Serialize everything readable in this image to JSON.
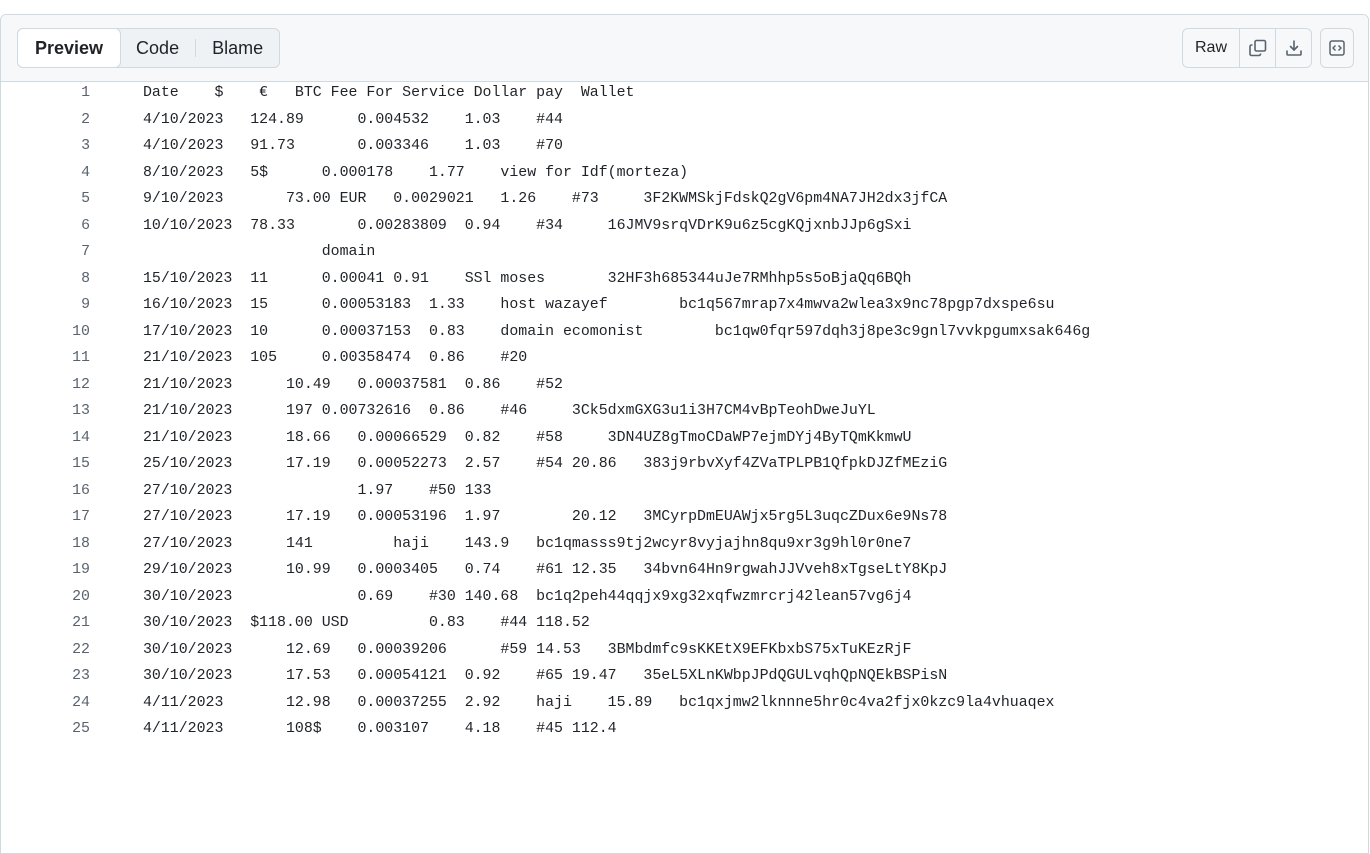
{
  "tabs": {
    "preview": "Preview",
    "code": "Code",
    "blame": "Blame"
  },
  "toolbar": {
    "raw": "Raw",
    "copy_icon": "copy-icon",
    "download_icon": "download-icon",
    "symbols_icon": "code-symbols-icon"
  },
  "lines": [
    {
      "n": "1",
      "text": "Date    $    €   BTC Fee For Service Dollar pay  Wallet"
    },
    {
      "n": "2",
      "text": "4/10/2023   124.89      0.004532    1.03    #44"
    },
    {
      "n": "3",
      "text": "4/10/2023   91.73       0.003346    1.03    #70"
    },
    {
      "n": "4",
      "text": "8/10/2023   5$      0.000178    1.77    view for Idf(morteza)"
    },
    {
      "n": "5",
      "text": "9/10/2023       73.00 EUR   0.0029021   1.26    #73     3F2KWMSkjFdskQ2gV6pm4NA7JH2dx3jfCA"
    },
    {
      "n": "6",
      "text": "10/10/2023  78.33       0.00283809  0.94    #34     16JMV9srqVDrK9u6z5cgKQjxnbJJp6gSxi"
    },
    {
      "n": "7",
      "text": "                    domain"
    },
    {
      "n": "8",
      "text": "15/10/2023  11      0.00041 0.91    SSl moses       32HF3h685344uJe7RMhhp5s5oBjaQq6BQh"
    },
    {
      "n": "9",
      "text": "16/10/2023  15      0.00053183  1.33    host wazayef        bc1q567mrap7x4mwva2wlea3x9nc78pgp7dxspe6su"
    },
    {
      "n": "10",
      "text": "17/10/2023  10      0.00037153  0.83    domain ecomonist        bc1qw0fqr597dqh3j8pe3c9gnl7vvkpgumxsak646g"
    },
    {
      "n": "11",
      "text": "21/10/2023  105     0.00358474  0.86    #20"
    },
    {
      "n": "12",
      "text": "21/10/2023      10.49   0.00037581  0.86    #52"
    },
    {
      "n": "13",
      "text": "21/10/2023      197 0.00732616  0.86    #46     3Ck5dxmGXG3u1i3H7CM4vBpTeohDweJuYL"
    },
    {
      "n": "14",
      "text": "21/10/2023      18.66   0.00066529  0.82    #58     3DN4UZ8gTmoCDaWP7ejmDYj4ByTQmKkmwU"
    },
    {
      "n": "15",
      "text": "25/10/2023      17.19   0.00052273  2.57    #54 20.86   383j9rbvXyf4ZVaTPLPB1QfpkDJZfMEziG"
    },
    {
      "n": "16",
      "text": "27/10/2023              1.97    #50 133"
    },
    {
      "n": "17",
      "text": "27/10/2023      17.19   0.00053196  1.97        20.12   3MCyrpDmEUAWjx5rg5L3uqcZDux6e9Ns78"
    },
    {
      "n": "18",
      "text": "27/10/2023      141         haji    143.9   bc1qmasss9tj2wcyr8vyjajhn8qu9xr3g9hl0r0ne7"
    },
    {
      "n": "19",
      "text": "29/10/2023      10.99   0.0003405   0.74    #61 12.35   34bvn64Hn9rgwahJJVveh8xTgseLtY8KpJ"
    },
    {
      "n": "20",
      "text": "30/10/2023              0.69    #30 140.68  bc1q2peh44qqjx9xg32xqfwzmrcrj42lean57vg6j4"
    },
    {
      "n": "21",
      "text": "30/10/2023  $118.00 USD         0.83    #44 118.52"
    },
    {
      "n": "22",
      "text": "30/10/2023      12.69   0.00039206      #59 14.53   3BMbdmfc9sKKEtX9EFKbxbS75xTuKEzRjF"
    },
    {
      "n": "23",
      "text": "30/10/2023      17.53   0.00054121  0.92    #65 19.47   35eL5XLnKWbpJPdQGULvqhQpNQEkBSPisN"
    },
    {
      "n": "24",
      "text": "4/11/2023       12.98   0.00037255  2.92    haji    15.89   bc1qxjmw2lknnne5hr0c4va2fjx0kzc9la4vhuaqex"
    },
    {
      "n": "25",
      "text": "4/11/2023       108$    0.003107    4.18    #45 112.4"
    }
  ]
}
